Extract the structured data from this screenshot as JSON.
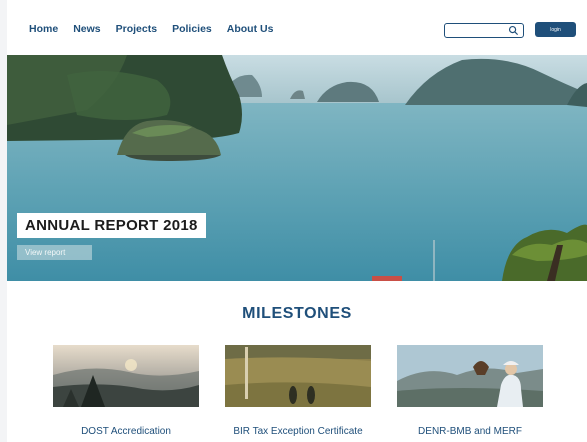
{
  "nav": {
    "links": [
      "Home",
      "News",
      "Projects",
      "Policies",
      "About Us"
    ],
    "search": {
      "placeholder": "",
      "icon": "search-icon"
    },
    "login_label": "login"
  },
  "hero": {
    "title": "ANNUAL REPORT 2018",
    "button_label": "View report"
  },
  "milestones": {
    "title": "MILESTONES",
    "cards": [
      {
        "label": "DOST Accredication"
      },
      {
        "label": "BIR Tax Exception Certificate"
      },
      {
        "label": "DENR-BMB and MERF"
      }
    ]
  },
  "colors": {
    "brand": "#1f4f7a",
    "background": "#ffffff"
  }
}
